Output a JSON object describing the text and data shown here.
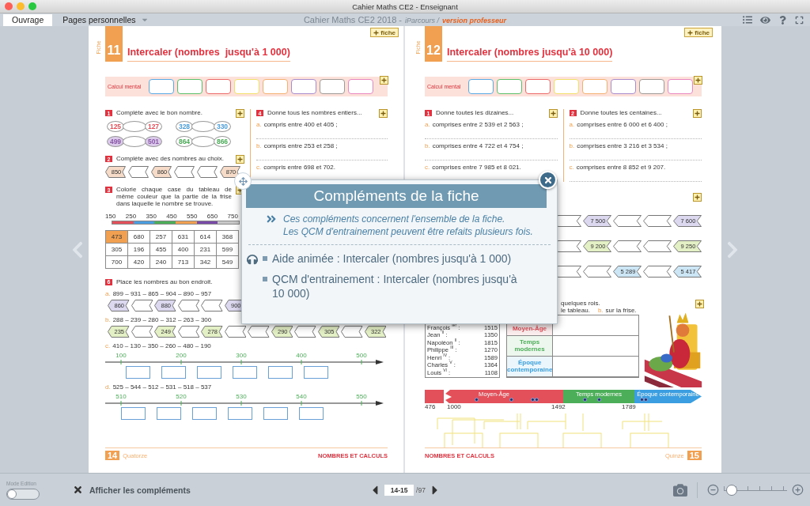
{
  "window": {
    "title": "Cahier Maths CE2 - Enseignant"
  },
  "tabs": [
    {
      "label": "Ouvrage",
      "selected": true,
      "dropdown": false
    },
    {
      "label": "Pages personnelles",
      "selected": false,
      "dropdown": true
    }
  ],
  "book_title": {
    "name": "Cahier Maths CE2 2018 -",
    "platform": "iParcours /",
    "edition": "version professeur"
  },
  "left_page": {
    "header": {
      "fiche_label": "Fiche",
      "number": "11",
      "title": "Intercaler (nombres  jusqu'à 1 000)"
    },
    "fiche_button": "fiche",
    "calcul_mental": {
      "label": "Calcul mental",
      "boxes": [
        {
          "color": "#5aaae6"
        },
        {
          "color": "#5cbf6a"
        },
        {
          "color": "#ec6a6a"
        },
        {
          "color": "#f2df6a"
        },
        {
          "color": "#f4b070"
        },
        {
          "color": "#a98ccc"
        },
        {
          "color": "#a09a96"
        },
        {
          "color": "#e887c0"
        }
      ]
    },
    "exercise_1": {
      "number": "1",
      "instruction": "Complète avec le bon nombre.",
      "clouds": [
        {
          "first": "125",
          "last": "127",
          "color": "#e4505a",
          "filled": false
        },
        {
          "first": "328",
          "last": "330",
          "color": "#4a9ee0",
          "filled": false
        },
        {
          "first": "499",
          "last": "501",
          "color": "#8a5aa8",
          "filled": true
        },
        {
          "first": "864",
          "last": "866",
          "color": "#4cae58",
          "filled": false
        }
      ]
    },
    "exercise_2": {
      "number": "2",
      "instruction": "Complète avec des nombres au choix.",
      "color": "#f6dcc8",
      "arrows": [
        {
          "kind": "number",
          "text": "850"
        },
        {
          "kind": "blank"
        },
        {
          "kind": "number",
          "text": "860"
        },
        {
          "kind": "blank"
        },
        {
          "kind": "blank"
        },
        {
          "kind": "number",
          "text": "870"
        }
      ]
    },
    "exercise_3": {
      "number": "3",
      "instruction": "Colorie chaque case du tableau de même couleur que la partie de la frise dans laquelle le nombre se trouve.",
      "scale": [
        "150",
        "250",
        "350",
        "450",
        "550",
        "650",
        "750"
      ],
      "segments": [
        {
          "color": "#e4505a"
        },
        {
          "color": "#4a9ee0"
        },
        {
          "color": "#4cae58"
        },
        {
          "color": "#f0a050"
        },
        {
          "color": "#7a4aa8"
        },
        {
          "color": "#c8c8c8"
        }
      ],
      "rows": [
        {
          "cells": [
            {
              "text": "473",
              "shaded": true
            },
            {
              "text": "680",
              "shaded": false
            },
            {
              "text": "257",
              "shaded": false
            },
            {
              "text": "631",
              "shaded": false
            },
            {
              "text": "614",
              "shaded": false
            },
            {
              "text": "368",
              "shaded": false
            }
          ]
        },
        {
          "cells": [
            {
              "text": "305",
              "shaded": false
            },
            {
              "text": "196",
              "shaded": false
            },
            {
              "text": "455",
              "shaded": false
            },
            {
              "text": "400",
              "shaded": false
            },
            {
              "text": "231",
              "shaded": false
            },
            {
              "text": "599",
              "shaded": false
            }
          ]
        },
        {
          "cells": [
            {
              "text": "700",
              "shaded": false
            },
            {
              "text": "420",
              "shaded": false
            },
            {
              "text": "240",
              "shaded": false
            },
            {
              "text": "713",
              "shaded": false
            },
            {
              "text": "342",
              "shaded": false
            },
            {
              "text": "549",
              "shaded": false
            }
          ]
        }
      ]
    },
    "exercise_4": {
      "number": "4",
      "instruction": "Donne tous les nombres entiers...",
      "items": [
        {
          "letter": "a.",
          "text": "compris entre 400 et 405 ;"
        },
        {
          "letter": "b.",
          "text": "compris entre 253 et 258 ;"
        },
        {
          "letter": "c.",
          "text": "compris entre 698 et 702."
        }
      ]
    },
    "exercise_6": {
      "number": "6",
      "instruction": "Place les nombres au bon endroit.",
      "parts": [
        {
          "kind": "arrows",
          "letter": "a.",
          "numbers": "899 – 931 – 865 – 904 – 890 – 957",
          "color": "#dcd8f0",
          "arrows": [
            {
              "kind": "number",
              "text": "860"
            },
            {
              "kind": "blank"
            },
            {
              "kind": "number",
              "text": "880"
            },
            {
              "kind": "blank"
            },
            {
              "kind": "blank"
            },
            {
              "kind": "number",
              "text": "900"
            }
          ]
        },
        {
          "kind": "arrows",
          "letter": "b.",
          "numbers": "288 – 239 – 280 – 312 – 263 – 300",
          "color": "#e3efc4",
          "arrows": [
            {
              "kind": "number",
              "text": "235"
            },
            {
              "kind": "blank"
            },
            {
              "kind": "number",
              "text": "249"
            },
            {
              "kind": "blank"
            },
            {
              "kind": "number",
              "text": "278"
            },
            {
              "kind": "blank"
            },
            {
              "kind": "blank"
            },
            {
              "kind": "number",
              "text": "290"
            },
            {
              "kind": "blank"
            },
            {
              "kind": "number",
              "text": "305"
            },
            {
              "kind": "blank"
            },
            {
              "kind": "number",
              "text": "322"
            }
          ]
        },
        {
          "kind": "line",
          "letter": "c.",
          "numbers": "410 – 130 – 350 – 260 – 480 – 190",
          "ticks": [
            "100",
            "200",
            "300",
            "400",
            "500"
          ]
        },
        {
          "kind": "line",
          "letter": "d.",
          "numbers": "525 – 544 – 512 – 531 – 518 – 537",
          "ticks": [
            "510",
            "520",
            "530",
            "540",
            "550"
          ]
        }
      ]
    },
    "footer": {
      "number": "14",
      "word": "Quatorze",
      "section": "NOMBRES ET CALCULS"
    }
  },
  "right_page": {
    "header": {
      "fiche_label": "Fiche",
      "number": "12",
      "title": "Intercaler (nombres jusqu'à 10 000)"
    },
    "fiche_button": "fiche",
    "calcul_mental": {
      "label": "Calcul mental",
      "boxes": [
        {
          "color": "#5aaae6"
        },
        {
          "color": "#5cbf6a"
        },
        {
          "color": "#ec6a6a"
        },
        {
          "color": "#f2df6a"
        },
        {
          "color": "#f4b070"
        },
        {
          "color": "#a98ccc"
        },
        {
          "color": "#a09a96"
        },
        {
          "color": "#e887c0"
        }
      ]
    },
    "exercise_1": {
      "number": "1",
      "instruction": "Donne toutes les dizaines...",
      "items": [
        {
          "letter": "a.",
          "text": "comprises entre 2 539 et 2 563 ;"
        },
        {
          "letter": "b.",
          "text": "comprises entre 4 722 et 4 754 ;"
        },
        {
          "letter": "c.",
          "text": "comprises entre 7 985 et 8 021."
        }
      ]
    },
    "exercise_2": {
      "number": "2",
      "instruction": "Donne toutes les centaines...",
      "items": [
        {
          "letter": "a.",
          "text": "comprises entre 6 000 et 6 400 ;"
        },
        {
          "letter": "b.",
          "text": "comprises entre 3 216 et 3 534 ;"
        },
        {
          "letter": "c.",
          "text": "comprises entre 8 852 et 9 207."
        }
      ]
    },
    "exercise_3": {
      "rows": [
        {
          "color": "#dcd8f0",
          "arrows": [
            {
              "kind": "blank"
            },
            {
              "kind": "number",
              "text": "7 500"
            },
            {
              "kind": "blank"
            },
            {
              "kind": "blank"
            },
            {
              "kind": "number",
              "text": "7 600"
            }
          ]
        },
        {
          "color": "#e3efc4",
          "arrows": [
            {
              "kind": "blank"
            },
            {
              "kind": "number",
              "text": "9 200"
            },
            {
              "kind": "blank"
            },
            {
              "kind": "blank"
            },
            {
              "kind": "number",
              "text": "9 250"
            }
          ]
        },
        {
          "color": "#cde6f5",
          "arrows": [
            {
              "kind": "blank"
            },
            {
              "kind": "blank"
            },
            {
              "kind": "number",
              "text": "5 289"
            },
            {
              "kind": "blank"
            },
            {
              "kind": "number",
              "text": "5 417"
            }
          ]
        }
      ]
    },
    "exercise_4": {
      "line": "quelques rois.",
      "part_a_end": "le tableau.",
      "letter": "b.",
      "part_b": "sur la frise.",
      "kings": [
        {
          "name": "François $^{Ier}$ :",
          "year": "1515"
        },
        {
          "name": "Jean $^{II}$ :",
          "year": "1350"
        },
        {
          "name": "Napoléon $^{II}$ :",
          "year": "1815"
        },
        {
          "name": "Philippe $^{III}$ :",
          "year": "1270"
        },
        {
          "name": "Henri $^{IV}$ :",
          "year": "1589"
        },
        {
          "name": "Charles $^{V}$ :",
          "year": "1364"
        },
        {
          "name": "Louis $^{VI}$ :",
          "year": "1108"
        }
      ],
      "periods": [
        {
          "label": "Moyen-Âge",
          "color": "#e4505a"
        },
        {
          "label": "Temps modernes",
          "color": "#4cae58"
        },
        {
          "label": "Époque contemporaine",
          "color": "#3a9ee0"
        }
      ]
    },
    "timeline": {
      "segments": [
        {
          "label": "Moyen-Âge",
          "color": "#e4505a"
        },
        {
          "label": "Temps modernes",
          "color": "#4cae58"
        },
        {
          "label": "Époque contemporaine",
          "color": "#3a9ee0"
        }
      ],
      "years": [
        "476",
        "1000",
        "1492",
        "1789"
      ]
    },
    "footer": {
      "number": "15",
      "word": "Quinze",
      "section": "NOMBRES ET CALCULS"
    }
  },
  "modal": {
    "title": "Compléments de la fiche",
    "intro": [
      "Ces compléments concernent l'ensemble de la fiche.",
      "Les QCM d'entrainement peuvent être refaits plusieurs fois."
    ],
    "items": [
      {
        "kind": "audio",
        "text": "Aide animée : Intercaler (nombres jusqu'à 1 000)"
      },
      {
        "kind": "quiz",
        "text": "QCM d'entrainement : Intercaler (nombres jusqu'à 10 000)"
      }
    ]
  },
  "bottom_bar": {
    "mode_label": "Mode Edition",
    "mode_on": false,
    "show_complements": {
      "label": "Afficher les compléments",
      "checked": true
    },
    "pager": {
      "value": "14-15",
      "total": "/97"
    },
    "zoom": {
      "level": 0.05
    }
  }
}
